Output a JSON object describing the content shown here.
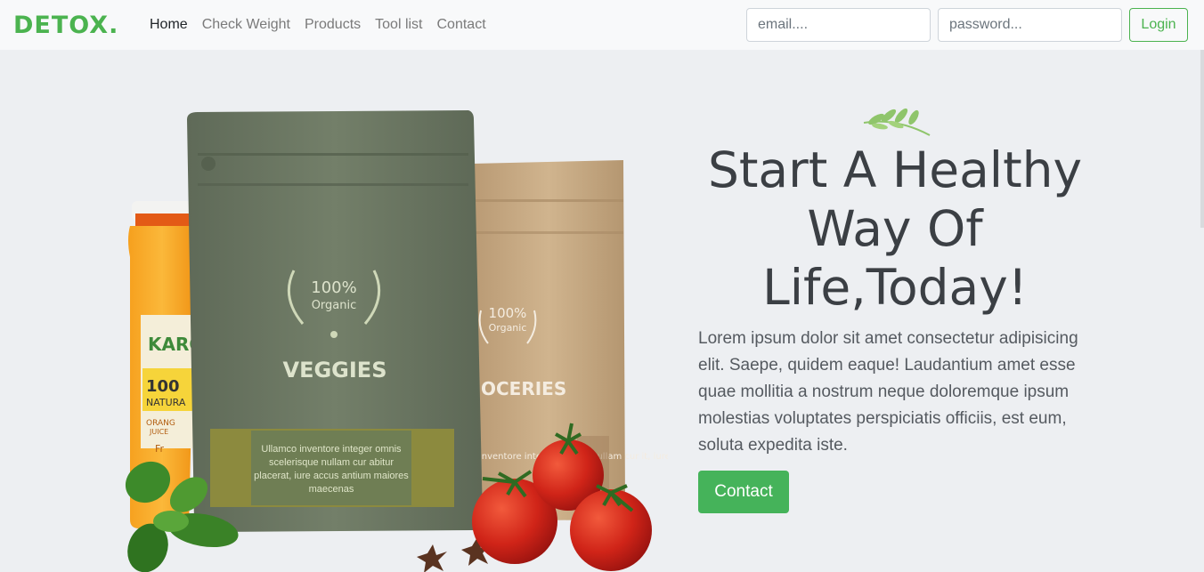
{
  "navbar": {
    "brand": "DETOX.",
    "links": [
      {
        "label": "Home",
        "active": true
      },
      {
        "label": "Check Weight",
        "active": false
      },
      {
        "label": "Products",
        "active": false
      },
      {
        "label": "Tool list",
        "active": false
      },
      {
        "label": "Contact",
        "active": false
      }
    ],
    "email_placeholder": "email....",
    "password_placeholder": "password...",
    "login_label": "Login"
  },
  "hero": {
    "heading": "Start A Healthy Way Of Life,Today!",
    "paragraph": "Lorem ipsum dolor sit amet consectetur adipisicing elit. Saepe, quidem eaque! Laudantium amet esse quae mollitia a nostrum neque doloremque ipsum molestias voluptates perspiciatis officiis, est eum, soluta expedita iste.",
    "contact_label": "Contact",
    "visual": {
      "bag_front": {
        "percent": "100%",
        "organic": "Organic",
        "name": "VEGGIES",
        "label_text": "Ullamco inventore integer omnis scelerisque nullam cur abitur placerat, iure accus antium maiores maecenas"
      },
      "bag_back": {
        "percent": "100%",
        "organic": "Organic",
        "name": "OCERIES",
        "label_text": "inventore integer nisque nullam cur it, iure accus maecenas"
      },
      "jar": {
        "brand": "KARO",
        "percent": "100",
        "natural": "NATURA",
        "sub1": "ORANG",
        "sub2": "JUICE",
        "sub3": "Fr"
      }
    }
  },
  "colors": {
    "accent": "#4bb34f",
    "button": "#45b35a",
    "bag_green": "#6c7863",
    "bag_kraft": "#c9ac86"
  }
}
